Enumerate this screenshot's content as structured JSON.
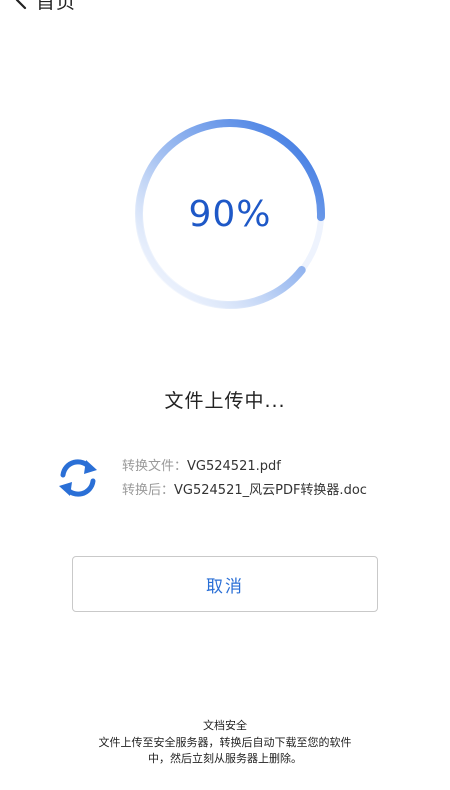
{
  "nav": {
    "title": "首页"
  },
  "progress": {
    "percent_text": "90%",
    "value": 0.9
  },
  "status_text": "文件上传中...",
  "files": {
    "source_label": "转换文件：",
    "source_name": "VG524521.pdf",
    "target_label": "转换后：",
    "target_name": "VG524521_风云PDF转换器.doc"
  },
  "cancel_label": "取消",
  "footer": {
    "title": "文档安全",
    "line1": "文件上传至安全服务器，转换后自动下载至您的软件",
    "line2": "中，然后立刻从服务器上删除。"
  },
  "colors": {
    "accent": "#2a6fd6",
    "percent": "#1e58c7",
    "ring_track": "#eef3fd",
    "ring_gradient_start": "#ffffff",
    "ring_gradient_end": "#2f6fe0"
  }
}
